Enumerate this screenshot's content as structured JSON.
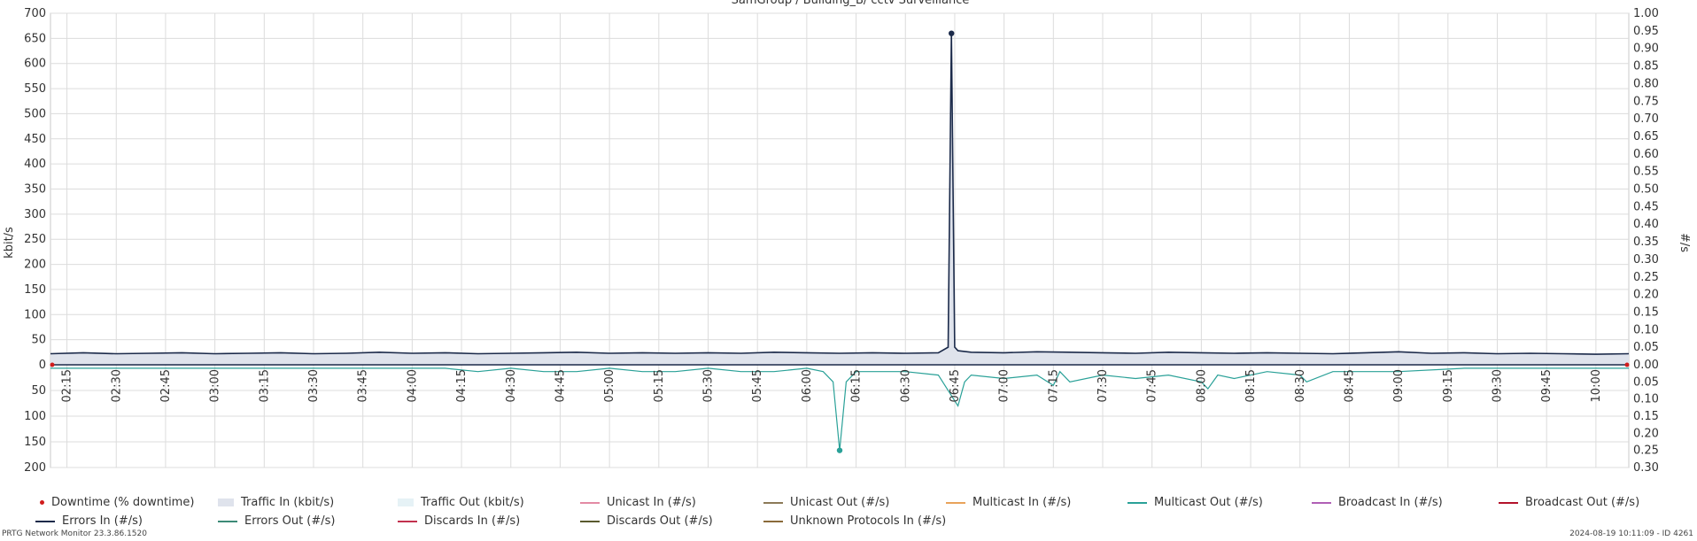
{
  "chart_data": {
    "type": "line",
    "title": "SamGroup / Building_B/ cctv Surveillance",
    "ylabel_left": "kbit/s",
    "ylabel_right": "#/s",
    "left_axis": {
      "upper_ticks": [
        700,
        650,
        600,
        550,
        500,
        450,
        400,
        350,
        300,
        250,
        200,
        150,
        100,
        50,
        0
      ],
      "lower_ticks": [
        50,
        100,
        150,
        200
      ],
      "range_in": [
        0,
        700
      ],
      "range_out": [
        0,
        200
      ]
    },
    "right_axis": {
      "upper_ticks": [
        "1.00",
        "0.95",
        "0.90",
        "0.85",
        "0.80",
        "0.75",
        "0.70",
        "0.65",
        "0.60",
        "0.55",
        "0.50",
        "0.45",
        "0.40",
        "0.35",
        "0.30",
        "0.25",
        "0.20",
        "0.15",
        "0.10",
        "0.05",
        "0.00"
      ],
      "lower_ticks": [
        "0.05",
        "0.10",
        "0.15",
        "0.20",
        "0.25",
        "0.30"
      ]
    },
    "x_ticks": [
      "02:15",
      "02:30",
      "02:45",
      "03:00",
      "03:15",
      "03:30",
      "03:45",
      "04:00",
      "04:15",
      "04:30",
      "04:45",
      "05:00",
      "05:15",
      "05:30",
      "05:45",
      "06:00",
      "06:15",
      "06:30",
      "06:45",
      "07:00",
      "07:15",
      "07:30",
      "07:45",
      "08:00",
      "08:15",
      "08:30",
      "08:45",
      "09:00",
      "09:15",
      "09:30",
      "09:45",
      "10:00"
    ],
    "x_range": [
      "02:10",
      "10:10"
    ],
    "grid": true,
    "series": [
      {
        "name": "Traffic In (kbit/s)",
        "color": "#1b2a4a",
        "fill": "#dfe3ec",
        "direction": "up",
        "x": [
          "02:10",
          "02:20",
          "02:30",
          "02:40",
          "02:50",
          "03:00",
          "03:10",
          "03:20",
          "03:30",
          "03:40",
          "03:50",
          "04:00",
          "04:10",
          "04:20",
          "04:30",
          "04:40",
          "04:50",
          "05:00",
          "05:10",
          "05:20",
          "05:30",
          "05:40",
          "05:50",
          "06:00",
          "06:10",
          "06:20",
          "06:30",
          "06:40",
          "06:43",
          "06:44",
          "06:45",
          "06:46",
          "06:50",
          "07:00",
          "07:10",
          "07:20",
          "07:30",
          "07:40",
          "07:50",
          "08:00",
          "08:10",
          "08:20",
          "08:30",
          "08:40",
          "08:50",
          "09:00",
          "09:10",
          "09:20",
          "09:30",
          "09:40",
          "09:50",
          "10:00",
          "10:10"
        ],
        "y": [
          22,
          24,
          22,
          23,
          24,
          22,
          23,
          24,
          22,
          23,
          25,
          23,
          24,
          22,
          23,
          24,
          25,
          23,
          24,
          23,
          24,
          23,
          25,
          24,
          23,
          24,
          23,
          24,
          35,
          660,
          35,
          28,
          25,
          24,
          26,
          25,
          24,
          23,
          25,
          24,
          23,
          24,
          23,
          22,
          24,
          26,
          23,
          24,
          22,
          23,
          22,
          21,
          22
        ]
      },
      {
        "name": "Multicast Out (#/s)",
        "color": "#2aa198",
        "direction": "down",
        "x": [
          "02:10",
          "02:30",
          "02:50",
          "03:10",
          "03:30",
          "03:50",
          "04:10",
          "04:20",
          "04:30",
          "04:40",
          "04:50",
          "05:00",
          "05:10",
          "05:20",
          "05:30",
          "05:40",
          "05:50",
          "06:00",
          "06:05",
          "06:08",
          "06:10",
          "06:12",
          "06:15",
          "06:30",
          "06:40",
          "06:46",
          "06:48",
          "06:50",
          "07:00",
          "07:10",
          "07:15",
          "07:17",
          "07:20",
          "07:30",
          "07:40",
          "07:50",
          "08:00",
          "08:02",
          "08:05",
          "08:10",
          "08:20",
          "08:30",
          "08:32",
          "08:40",
          "09:00",
          "09:20",
          "09:40",
          "10:00",
          "10:10"
        ],
        "y": [
          0.01,
          0.01,
          0.01,
          0.01,
          0.01,
          0.01,
          0.01,
          0.02,
          0.01,
          0.02,
          0.02,
          0.01,
          0.02,
          0.02,
          0.01,
          0.02,
          0.02,
          0.01,
          0.02,
          0.05,
          0.25,
          0.05,
          0.02,
          0.02,
          0.03,
          0.12,
          0.05,
          0.03,
          0.04,
          0.03,
          0.06,
          0.02,
          0.05,
          0.03,
          0.04,
          0.03,
          0.05,
          0.07,
          0.03,
          0.04,
          0.02,
          0.03,
          0.05,
          0.02,
          0.02,
          0.01,
          0.01,
          0.01,
          0.01
        ]
      }
    ]
  },
  "legend": {
    "row1": [
      {
        "label": "Downtime (% downtime)",
        "color": "#d01c1c",
        "kind": "dot"
      },
      {
        "label": "Traffic In (kbit/s)",
        "color": "#dfe3ec",
        "kind": "box"
      },
      {
        "label": "Traffic Out (kbit/s)",
        "color": "#e6f2f6",
        "kind": "box"
      },
      {
        "label": "Unicast In (#/s)",
        "color": "#e38aa4",
        "kind": "line"
      },
      {
        "label": "Unicast Out (#/s)",
        "color": "#8c7a58",
        "kind": "line"
      },
      {
        "label": "Multicast In (#/s)",
        "color": "#e8a35a",
        "kind": "line"
      },
      {
        "label": "Multicast Out (#/s)",
        "color": "#2aa198",
        "kind": "line"
      },
      {
        "label": "Broadcast In (#/s)",
        "color": "#b05fb5",
        "kind": "line"
      },
      {
        "label": "Broadcast Out (#/s)",
        "color": "#b3122b",
        "kind": "line"
      }
    ],
    "row2": [
      {
        "label": "Errors In (#/s)",
        "color": "#1b2a4a",
        "kind": "line"
      },
      {
        "label": "Errors Out (#/s)",
        "color": "#3c8a77",
        "kind": "line"
      },
      {
        "label": "Discards In (#/s)",
        "color": "#c2314e",
        "kind": "line"
      },
      {
        "label": "Discards Out (#/s)",
        "color": "#5a5a2e",
        "kind": "line"
      },
      {
        "label": "Unknown Protocols In (#/s)",
        "color": "#8a6a3a",
        "kind": "line"
      }
    ]
  },
  "footer": {
    "left": "PRTG Network Monitor 23.3.86.1520",
    "right": "2024-08-19 10:11:09 - ID 4261"
  }
}
